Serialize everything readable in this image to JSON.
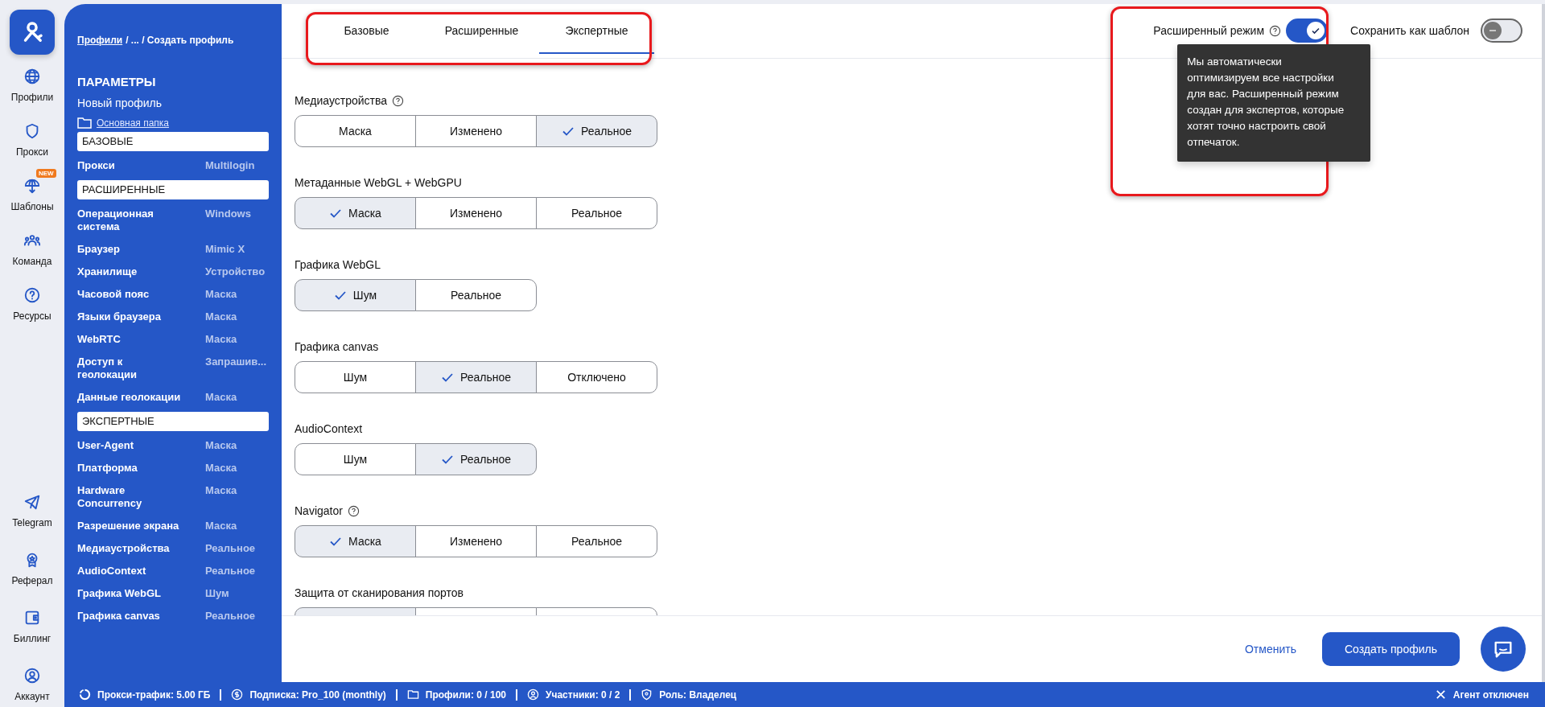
{
  "rail": {
    "top_items": [
      {
        "kind": "globe",
        "label": "Профили"
      },
      {
        "kind": "shield",
        "label": "Прокси"
      },
      {
        "kind": "template",
        "label": "Шаблоны",
        "badge": "NEW"
      },
      {
        "kind": "team",
        "label": "Команда"
      },
      {
        "kind": "question",
        "label": "Ресурсы"
      }
    ],
    "bottom_items": [
      {
        "kind": "telegram",
        "label": "Telegram"
      },
      {
        "kind": "award",
        "label": "Реферал"
      },
      {
        "kind": "wallet",
        "label": "Биллинг"
      },
      {
        "kind": "user",
        "label": "Аккаунт"
      }
    ]
  },
  "sidebar": {
    "breadcrumb_link": "Профили",
    "breadcrumb_rest": "/ ... / Создать профиль",
    "title": "ПАРАМЕТРЫ",
    "profile_name": "Новый профиль",
    "folder": "Основная папка",
    "sections": [
      {
        "title": "БАЗОВЫЕ",
        "items": [
          {
            "name": "Прокси",
            "value": "Multilogin"
          }
        ]
      },
      {
        "title": "РАСШИРЕННЫЕ",
        "items": [
          {
            "name": "Операционная система",
            "value": "Windows"
          },
          {
            "name": "Браузер",
            "value": "Mimic X"
          },
          {
            "name": "Хранилище",
            "value": "Устройство"
          },
          {
            "name": "Часовой пояс",
            "value": "Маска"
          },
          {
            "name": "Языки браузера",
            "value": "Маска"
          },
          {
            "name": "WebRTC",
            "value": "Маска"
          },
          {
            "name": "Доступ к геолокации",
            "value": "Запрашив..."
          },
          {
            "name": "Данные геолокации",
            "value": "Маска"
          }
        ]
      },
      {
        "title": "ЭКСПЕРТНЫЕ",
        "items": [
          {
            "name": "User-Agent",
            "value": "Маска"
          },
          {
            "name": "Платформа",
            "value": "Маска"
          },
          {
            "name": "Hardware Concurrency",
            "value": "Маска"
          },
          {
            "name": "Разрешение экрана",
            "value": "Маска"
          },
          {
            "name": "Медиаустройства",
            "value": "Реальное"
          },
          {
            "name": "AudioContext",
            "value": "Реальное"
          },
          {
            "name": "Графика WebGL",
            "value": "Шум"
          },
          {
            "name": "Графика canvas",
            "value": "Реальное"
          }
        ]
      }
    ]
  },
  "tabs": [
    {
      "label": "Базовые",
      "selected": false
    },
    {
      "label": "Расширенные",
      "selected": false
    },
    {
      "label": "Экспертные",
      "selected": true
    }
  ],
  "advanced_mode": {
    "label": "Расширенный режим",
    "on": true,
    "tooltip": "Мы автоматически оптимизируем все настройки для вас. Расширенный режим создан для экспертов, которые хотят точно настроить свой отпечаток."
  },
  "save_template": {
    "label": "Сохранить как шаблон",
    "on": false
  },
  "settings": [
    {
      "label": "Медиаустройства",
      "help": true,
      "options": [
        {
          "label": "Маска",
          "selected": false
        },
        {
          "label": "Изменено",
          "selected": false
        },
        {
          "label": "Реальное",
          "selected": true
        }
      ]
    },
    {
      "label": "Метаданные WebGL + WebGPU",
      "help": false,
      "options": [
        {
          "label": "Маска",
          "selected": true
        },
        {
          "label": "Изменено",
          "selected": false
        },
        {
          "label": "Реальное",
          "selected": false
        }
      ]
    },
    {
      "label": "Графика WebGL",
      "help": false,
      "options": [
        {
          "label": "Шум",
          "selected": true
        },
        {
          "label": "Реальное",
          "selected": false
        }
      ]
    },
    {
      "label": "Графика canvas",
      "help": false,
      "options": [
        {
          "label": "Шум",
          "selected": false
        },
        {
          "label": "Реальное",
          "selected": true
        },
        {
          "label": "Отключено",
          "selected": false
        }
      ]
    },
    {
      "label": "AudioContext",
      "help": false,
      "options": [
        {
          "label": "Шум",
          "selected": false
        },
        {
          "label": "Реальное",
          "selected": true
        }
      ]
    },
    {
      "label": "Navigator",
      "help": true,
      "options": [
        {
          "label": "Маска",
          "selected": true
        },
        {
          "label": "Изменено",
          "selected": false
        },
        {
          "label": "Реальное",
          "selected": false
        }
      ]
    },
    {
      "label": "Защита от сканирования портов",
      "help": false,
      "options": [
        {
          "selected": true
        },
        {
          "selected": false
        },
        {
          "selected": false
        }
      ]
    }
  ],
  "footer": {
    "cancel": "Отменить",
    "create": "Создать профиль"
  },
  "status_bar": {
    "items": [
      {
        "kind": "traffic",
        "text": "Прокси-трафик: 5.00 ГБ"
      },
      {
        "kind": "dollar",
        "text": "Подписка: Pro_100 (monthly)"
      },
      {
        "kind": "folder",
        "text": "Профили: 0 / 100"
      },
      {
        "kind": "user",
        "text": "Участники: 0 / 2"
      },
      {
        "kind": "shield",
        "text": "Роль: Владелец"
      }
    ],
    "agent": "Агент отключен"
  }
}
